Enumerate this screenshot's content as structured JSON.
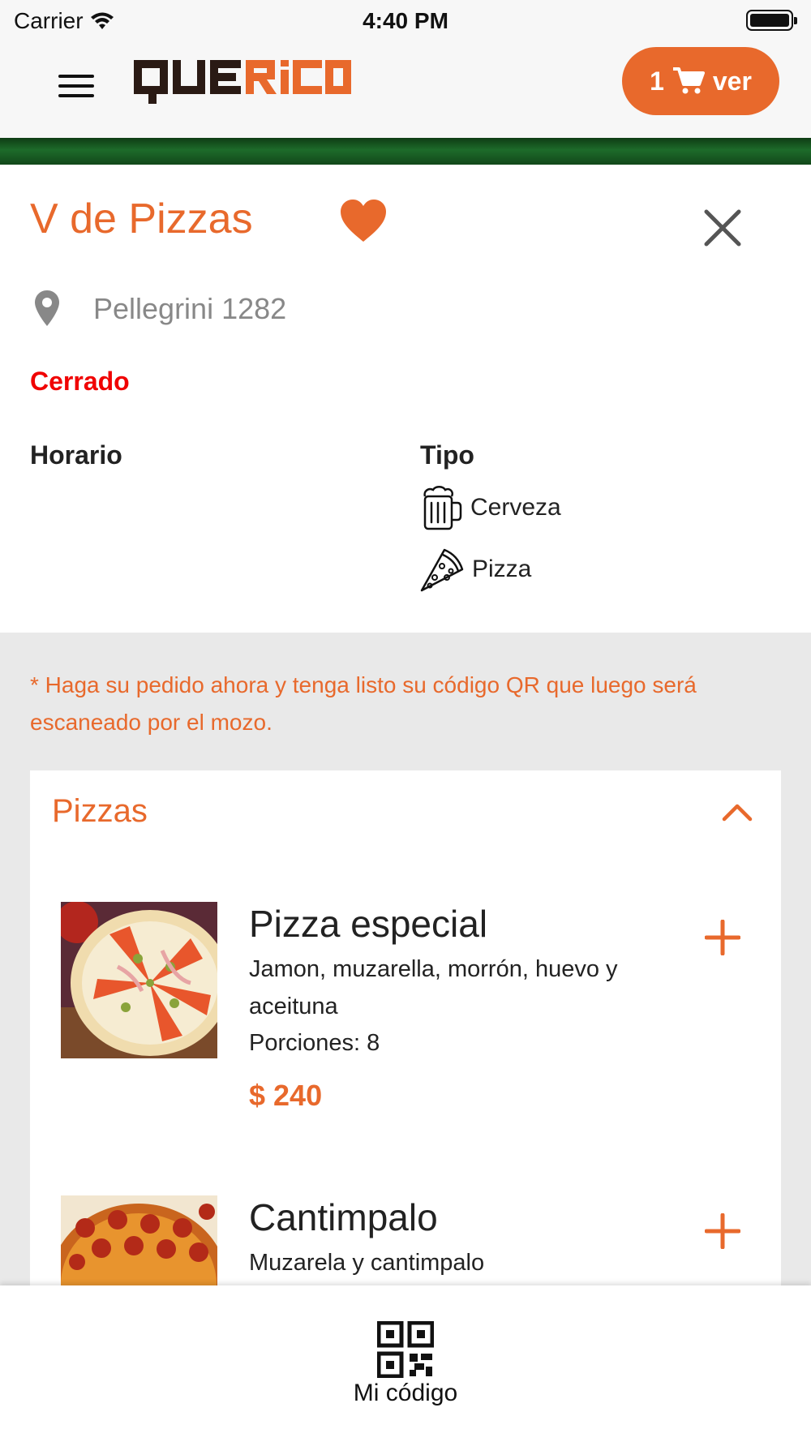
{
  "status_bar": {
    "carrier": "Carrier",
    "time": "4:40 PM"
  },
  "header": {
    "logo_text": "QUERICO",
    "cart": {
      "count": "1",
      "label": "ver"
    }
  },
  "restaurant": {
    "name": "V de Pizzas",
    "address": "Pellegrini 1282",
    "status": "Cerrado",
    "schedule_label": "Horario",
    "type_label": "Tipo",
    "types": [
      {
        "label": "Cerveza",
        "icon": "beer-mug-icon"
      },
      {
        "label": "Pizza",
        "icon": "pizza-slice-icon"
      }
    ]
  },
  "notice": "* Haga su pedido ahora y tenga listo su código QR que luego será escaneado por el mozo.",
  "menu": {
    "category": "Pizzas",
    "items": [
      {
        "name": "Pizza especial",
        "description": "Jamon, muzarella, morrón, huevo y aceituna",
        "portions": "Porciones: 8",
        "price": "$ 240"
      },
      {
        "name": "Cantimpalo",
        "description": "Muzarela y cantimpalo"
      }
    ]
  },
  "tab_bar": {
    "my_code_label": "Mi código"
  },
  "colors": {
    "accent": "#e8692c",
    "closed": "#f00000",
    "green_band": "#1d6b2a"
  }
}
